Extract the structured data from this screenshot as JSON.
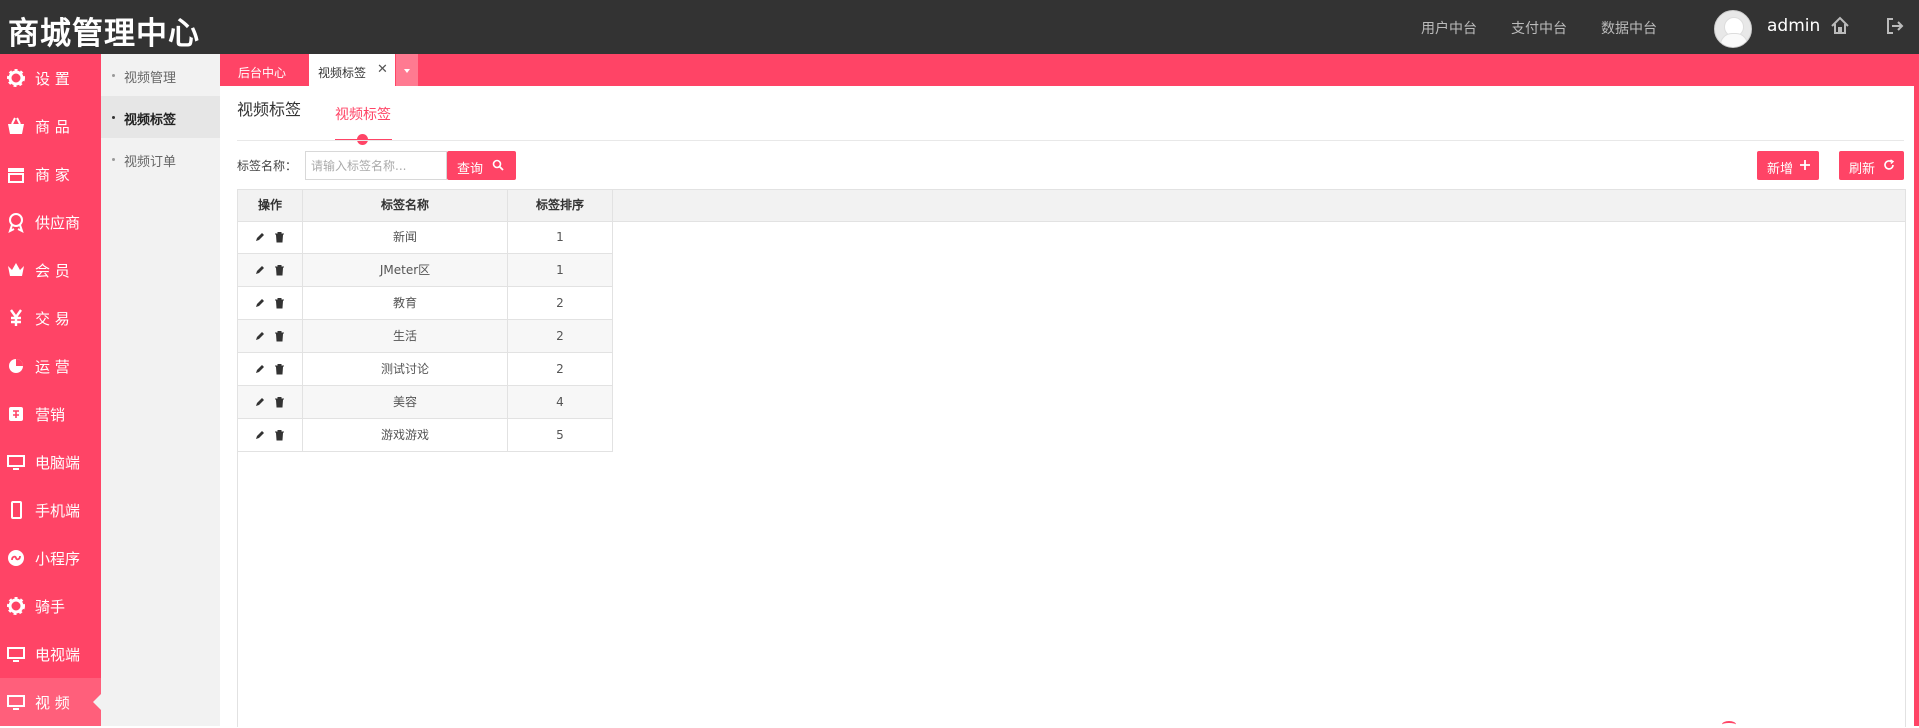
{
  "header": {
    "app_title": "商城管理中心",
    "nav": [
      "用户中台",
      "支付中台",
      "数据中台"
    ],
    "user_name": "admin",
    "icons": {
      "home": "home-icon",
      "logout": "logout-icon"
    }
  },
  "sidebar": {
    "items": [
      {
        "label": "设 置",
        "icon": "gear-icon"
      },
      {
        "label": "商 品",
        "icon": "basket-icon"
      },
      {
        "label": "商 家",
        "icon": "store-icon"
      },
      {
        "label": "供应商",
        "icon": "award-icon"
      },
      {
        "label": "会 员",
        "icon": "crown-icon"
      },
      {
        "label": "交 易",
        "icon": "yen-icon"
      },
      {
        "label": "运 营",
        "icon": "pie-chart-icon"
      },
      {
        "label": "营销",
        "icon": "promo-icon"
      },
      {
        "label": "电脑端",
        "icon": "monitor-icon"
      },
      {
        "label": "手机端",
        "icon": "mobile-icon"
      },
      {
        "label": "小程序",
        "icon": "mini-program-icon"
      },
      {
        "label": "骑手",
        "icon": "gear-icon"
      },
      {
        "label": "电视端",
        "icon": "monitor-icon"
      },
      {
        "label": "视 频",
        "icon": "monitor-icon",
        "active": true
      }
    ]
  },
  "subnav": {
    "items": [
      "视频管理",
      "视频标签",
      "视频订单"
    ],
    "active_index": 1
  },
  "tabs": {
    "home": "后台中心",
    "active": "视频标签",
    "close": "✕"
  },
  "page": {
    "title": "视频标签",
    "sub_tab": "视频标签"
  },
  "search": {
    "label": "标签名称：",
    "placeholder": "请输入标签名称...",
    "value": "",
    "search_button": "查询",
    "add_button": "新增",
    "refresh_button": "刷新"
  },
  "table": {
    "headers": [
      "操作",
      "标签名称",
      "标签排序"
    ],
    "rows": [
      {
        "name": "新闻",
        "sort": "1"
      },
      {
        "name": "JMeter区",
        "sort": "1"
      },
      {
        "name": "教育",
        "sort": "2"
      },
      {
        "name": "生活",
        "sort": "2"
      },
      {
        "name": "测试讨论",
        "sort": "2"
      },
      {
        "name": "美容",
        "sort": "4"
      },
      {
        "name": "游戏游戏",
        "sort": "5"
      }
    ]
  },
  "colors": {
    "accent": "#ff4466",
    "header_bg": "#333333",
    "subnav_bg": "#f2f2f2"
  }
}
